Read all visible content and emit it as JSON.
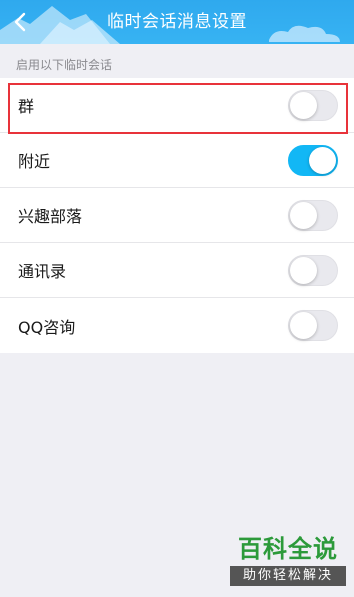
{
  "header": {
    "title": "临时会话消息设置",
    "back_icon": "chevron-left-icon",
    "color": "#33aef1"
  },
  "section_label": "启用以下临时会话",
  "settings": [
    {
      "label": "群",
      "enabled": false
    },
    {
      "label": "附近",
      "enabled": true
    },
    {
      "label": "兴趣部落",
      "enabled": false
    },
    {
      "label": "通讯录",
      "enabled": false
    },
    {
      "label": "QQ咨询",
      "enabled": false
    }
  ],
  "accent_color": "#12b7f5",
  "highlight_color": "#e8333a",
  "watermark": {
    "main": "百科全说",
    "sub": "助你轻松解决"
  }
}
